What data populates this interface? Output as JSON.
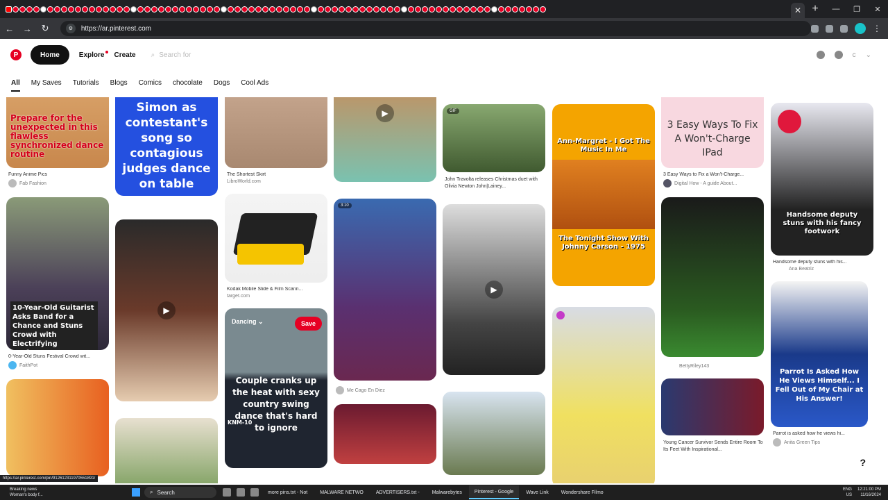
{
  "browser": {
    "url": "https://ar.pinterest.com",
    "status_url": "https://ar.pinterest.com/pin/9126123119705518​91/"
  },
  "header": {
    "logo": "P",
    "home": "Home",
    "explore": "Explore",
    "create": "Create",
    "search_placeholder": "Search for",
    "account_initial": "c"
  },
  "categories": [
    "All",
    "My Saves",
    "Tutorials",
    "Blogs",
    "Comics",
    "chocolate",
    "Dogs",
    "Cool Ads"
  ],
  "pins": {
    "c1a_text": "Prepare for the unexpected in this flawless synchronized dance routine",
    "c1a_caption": "Funny Anime Pics",
    "c1a_source": "Fab Fashion",
    "c1b_text": "10-Year-Old Guitarist Asks Band for a Chance and Stuns Crowd with Electrifying Performance",
    "c1b_caption": "0-Year-Old Stuns Festival Crowd wit...",
    "c1b_source": "FaithPot",
    "c2a_text": "Simon as contestant's song so contagious judges dance on table",
    "c3a_caption": "The Shortest Skirt",
    "c3a_source": "LibroWorld.com",
    "c3b_caption": "Kodak Mobile Slide & Film Scann...",
    "c3b_source": "target.com",
    "c3c_board": "Dancing",
    "c3c_save": "Save",
    "c3c_text": "Couple cranks up the heat with sexy country swing dance that's hard to ignore",
    "c3c_tag": "KNM-10",
    "c4b_time": "3:10",
    "c4b_source": "Me Cago En Diez",
    "c5a_badge": "GIF",
    "c5a_caption": "John Travolta releases Christmas duet with Olivia Newton John|Lainey...",
    "c6a_top": "Ann-Margret - I Got The Music In Me",
    "c6a_bottom": "The Tonight Show With Johnny Carson - 1975",
    "c7a_text": "3 Easy Ways To Fix A Won't-Charge IPad",
    "c7a_caption": "3 Easy Ways to Fix a Won't-Charge...",
    "c7a_source": "Digital How - A guide About...",
    "c7b_source": "BettyRiley143",
    "c7c_caption": "Young Cancer Survivor Sends Entire Room To Its Feet With Inspirational...",
    "c8a_text": "Handsome deputy stuns with his fancy footwork",
    "c8a_caption": "Handsome deputy stuns with his...",
    "c8a_source": "Ana Beatriz",
    "c8b_text": "Parrot Is Asked How He Views Himself... I Fell Out of My Chair at His Answer!",
    "c8b_caption": "Parrot is asked how he views hi...",
    "c8b_source": "Anita Green Tips"
  },
  "taskbar": {
    "news_title": "Breaking news",
    "news_sub": "Woman's body f...",
    "search": "Search",
    "apps": [
      "more pins.txt - Not",
      "MALWARE NETWO",
      "ADVERTISERS.txt -",
      "Malwarebytes",
      "Pinterest - Google",
      "Wave Link",
      "Wondershare Filmo"
    ],
    "lang": "ENG",
    "region": "US",
    "time": "12:21:00 PM",
    "date": "11/16/2024"
  },
  "colors": {
    "brand": "#e60023"
  }
}
